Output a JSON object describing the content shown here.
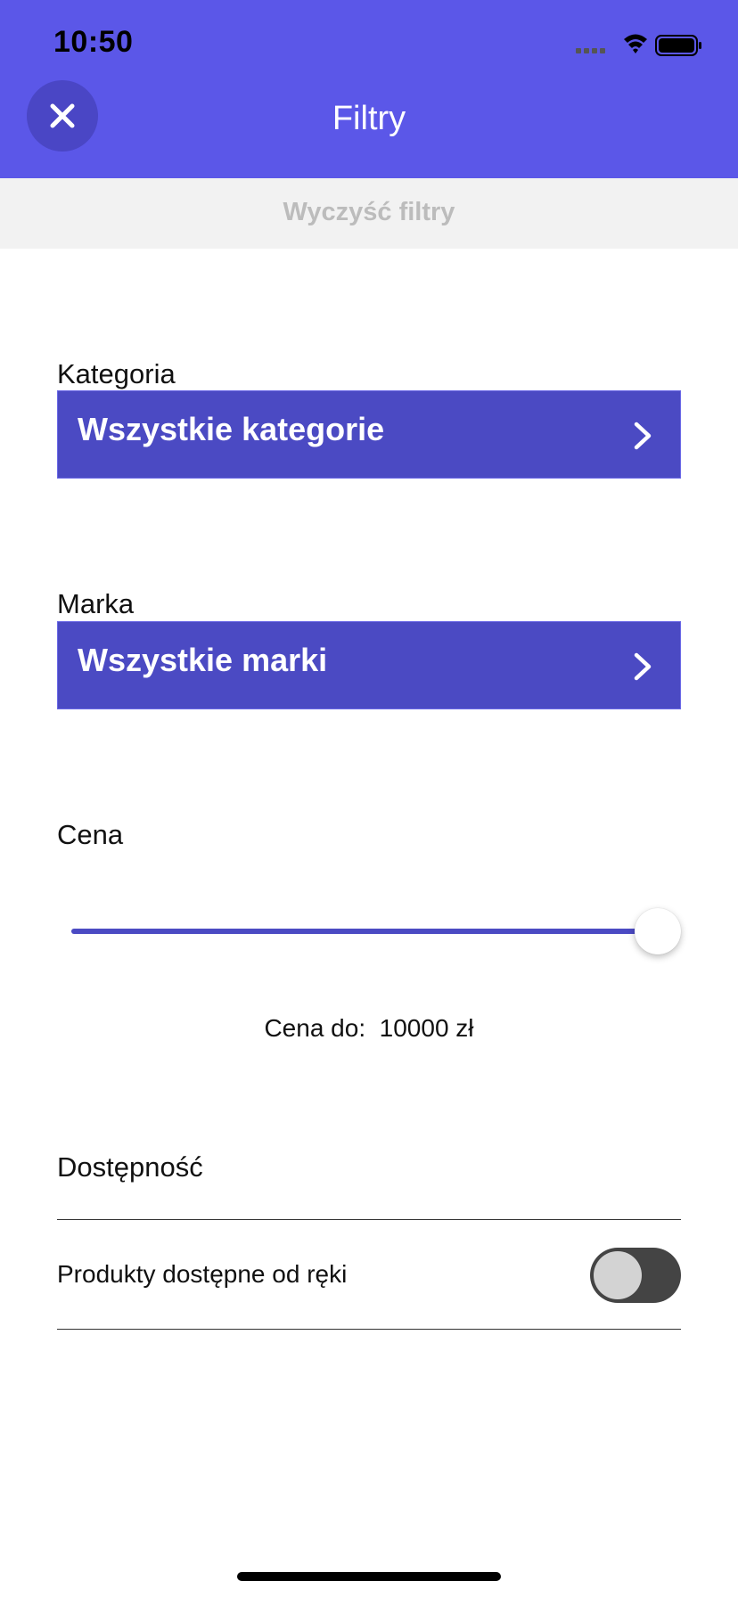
{
  "status_bar": {
    "time": "10:50"
  },
  "header": {
    "title": "Filtry",
    "close_icon": "close-icon"
  },
  "clear_filters": {
    "label": "Wyczyść filtry"
  },
  "category": {
    "label": "Kategoria",
    "value": "Wszystkie kategorie"
  },
  "brand": {
    "label": "Marka",
    "value": "Wszystkie marki"
  },
  "price": {
    "label": "Cena",
    "slider_fraction": 1.0,
    "caption_prefix": "Cena do:",
    "caption_value": "10000 zł"
  },
  "availability": {
    "label": "Dostępność",
    "option_label": "Produkty dostępne od ręki",
    "toggle_on": false
  },
  "colors": {
    "accent": "#5b57e8",
    "select_background": "#4b4ac3"
  }
}
